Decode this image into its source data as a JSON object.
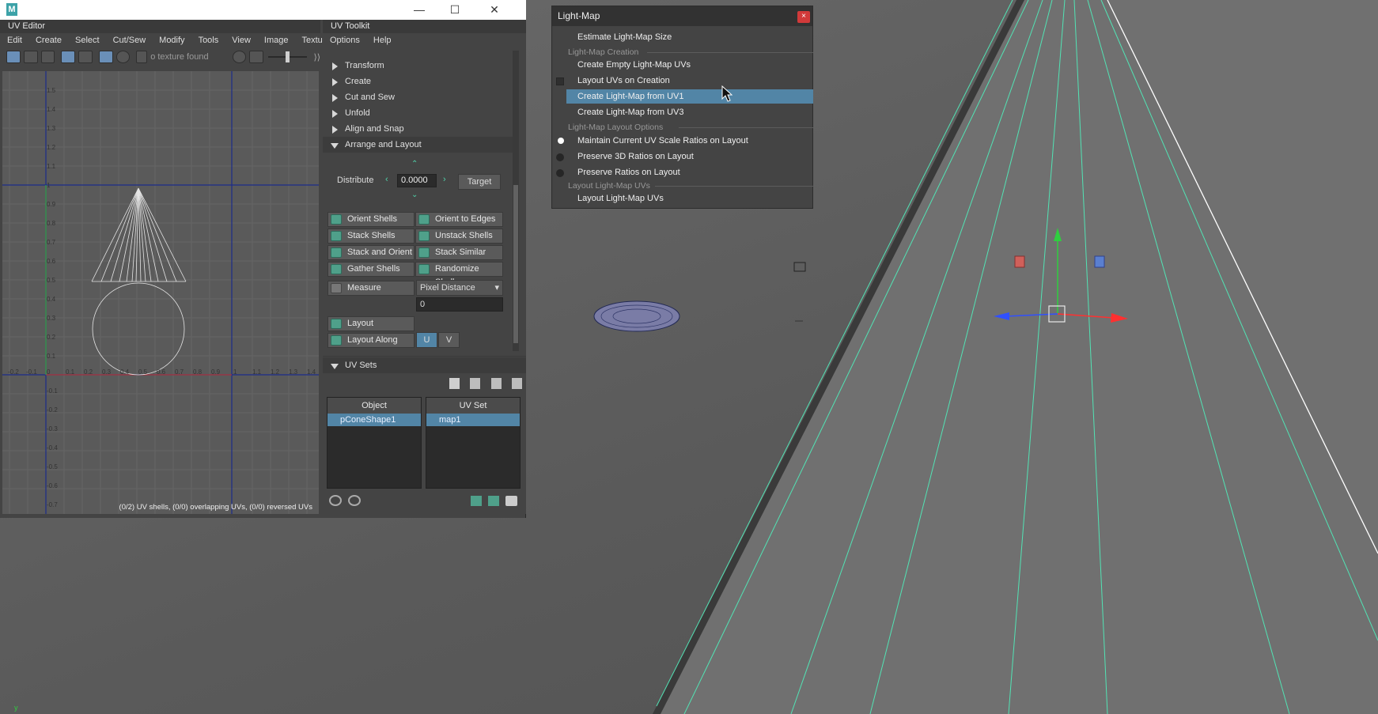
{
  "window": {
    "app_logo": "M",
    "controls": [
      "minimize-icon",
      "maximize-icon",
      "close-icon"
    ]
  },
  "uv_editor": {
    "title": "UV Editor",
    "menu": [
      "Edit",
      "Create",
      "Select",
      "Cut/Sew",
      "Modify",
      "Tools",
      "View",
      "Image",
      "Textures"
    ],
    "texture_label": "o texture found",
    "status": "(0/2) UV shells, (0/0) overlapping UVs, (0/0) reversed UVs",
    "y_ticks": [
      "1.5",
      "1.4",
      "1.3",
      "1.2",
      "1.1",
      "1",
      "0.9",
      "0.8",
      "0.7",
      "0.6",
      "0.5",
      "0.4",
      "0.3",
      "0.2",
      "0.1",
      "0",
      "-0.1",
      "-0.2",
      "-0.3",
      "-0.4",
      "-0.5",
      "-0.6",
      "-0.7"
    ],
    "x_ticks": [
      "-0.2",
      "-0.1",
      "0",
      "0.1",
      "0.2",
      "0.3",
      "0.4",
      "0.5",
      "0.6",
      "0.7",
      "0.8",
      "0.9",
      "1",
      "1.1",
      "1.2",
      "1.3",
      "1.4"
    ]
  },
  "uv_toolkit": {
    "title": "UV Toolkit",
    "menu": [
      "Options",
      "Help"
    ],
    "sections": [
      "Transform",
      "Create",
      "Cut and Sew",
      "Unfold",
      "Align and Snap",
      "Arrange and Layout"
    ],
    "distribute_label": "Distribute",
    "distribute_value": "0.0000",
    "target_label": "Target",
    "buttons": {
      "orient_shells": "Orient Shells",
      "orient_edges": "Orient to Edges",
      "stack_shells": "Stack Shells",
      "unstack_shells": "Unstack Shells",
      "stack_orient": "Stack and Orient",
      "stack_similar": "Stack Similar",
      "gather_shells": "Gather Shells",
      "randomize_shells": "Randomize Shells",
      "measure": "Measure",
      "layout": "Layout",
      "layout_along": "Layout Along"
    },
    "measure_mode": "Pixel Distance",
    "measure_value": "0",
    "u_label": "U",
    "v_label": "V",
    "uv_sets_section": "UV Sets",
    "object_header": "Object",
    "uvset_header": "UV Set",
    "object_value": "pConeShape1",
    "uvset_value": "map1"
  },
  "light_map": {
    "title": "Light-Map",
    "close": "×",
    "items": {
      "estimate": "Estimate Light-Map Size",
      "hdr_creation": "Light-Map Creation",
      "create_empty": "Create Empty Light-Map UVs",
      "layout_on_creation": "Layout UVs on Creation",
      "from_uv1": "Create Light-Map from UV1",
      "from_uv3": "Create Light-Map from UV3",
      "hdr_layout_opts": "Light-Map Layout Options",
      "maintain": "Maintain Current UV Scale Ratios on Layout",
      "preserve3d": "Preserve 3D Ratios on Layout",
      "preserve": "Preserve Ratios on Layout",
      "hdr_layout": "Layout Light-Map UVs",
      "layout_lm": "Layout Light-Map UVs"
    }
  },
  "viewport": {
    "axis_label": "y",
    "line_color": "#52e3b4"
  }
}
